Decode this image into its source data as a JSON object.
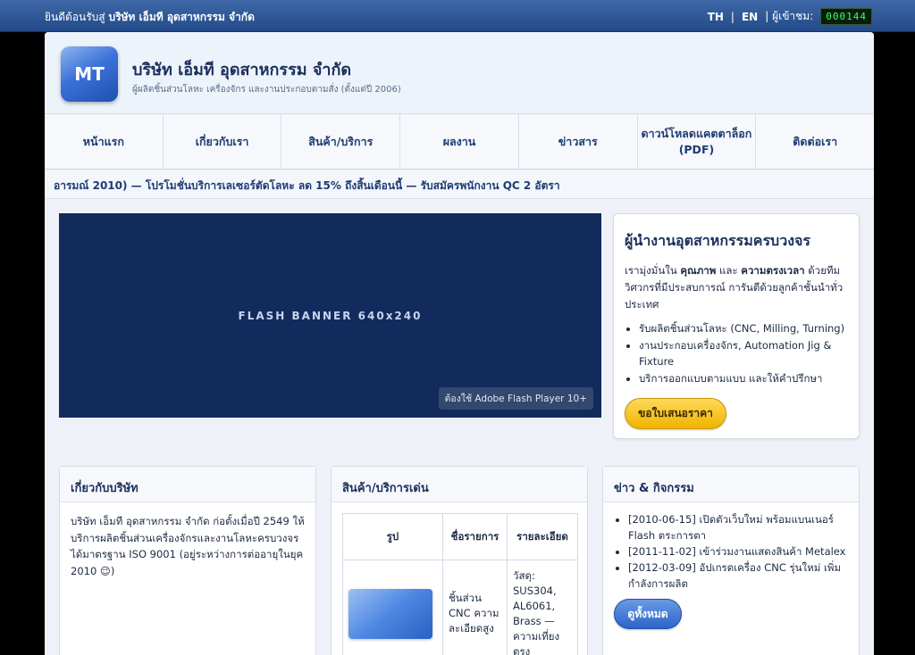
{
  "topbar": {
    "welcome_prefix": "ยินดีต้อนรับสู่",
    "welcome_company": "บริษัท เอ็มที อุดสาหกรรม จำกัด",
    "lang_th": "TH",
    "lang_sep": "|",
    "lang_en": "EN",
    "visitors_label": "| ผู้เข้าชม:",
    "visitors_count": "000144"
  },
  "header": {
    "logo_text": "MT",
    "company_name": "บริษัท เอ็มที อุดสาหกรรม จำกัด",
    "tagline": "ผู้ผลิตชิ้นส่วนโลหะ เครื่องจักร และงานประกอบตามสั่ง (ตั้งแต่ปี 2006)"
  },
  "nav": {
    "items": [
      {
        "label": "หน้าแรก"
      },
      {
        "label": "เกี่ยวกับเรา"
      },
      {
        "label": "สินค้า/บริการ"
      },
      {
        "label": "ผลงาน"
      },
      {
        "label": "ข่าวสาร"
      },
      {
        "label": "ดาวน์โหลดแคตตาล็อก (PDF)"
      },
      {
        "label": "ติดต่อเรา"
      }
    ]
  },
  "ticker": {
    "text": "อารมณ์ 2010) — โปรโมชั่นบริการเลเซอร์ตัดโลหะ ลด 15% ถึงสิ้นเดือนนี้ — รับสมัครพนักงาน QC 2 อัตรา"
  },
  "banner": {
    "label": "FLASH BANNER 640x240",
    "requirement": "ต้องใช้ Adobe Flash Player 10+"
  },
  "promo": {
    "title": "ผู้นำงานอุตสาหกรรมครบวงจร",
    "desc_1": "เรามุ่งมั่นใน ",
    "desc_bold_1": "คุณภาพ",
    "desc_2": " และ ",
    "desc_bold_2": "ความตรงเวลา",
    "desc_3": " ด้วยทีมวิศวกรที่มีประสบการณ์ การันตีด้วยลูกค้าชั้นนำทั่วประเทศ",
    "bullets": [
      "รับผลิตชิ้นส่วนโลหะ (CNC, Milling, Turning)",
      "งานประกอบเครื่องจักร, Automation Jig & Fixture",
      "บริการออกแบบตามแบบ และให้คำปรึกษา"
    ],
    "quote_button": "ขอใบเสนอราคา"
  },
  "about": {
    "title": "เกี่ยวกับบริษัท",
    "body": "บริษัท เอ็มที อุดสาหกรรม จำกัด ก่อตั้งเมื่อปี 2549 ให้บริการผลิตชิ้นส่วนเครื่องจักรและงานโลหะครบวงจร ได้มาตรฐาน ISO 9001 (อยู่ระหว่างการต่ออายุในยุค 2010 😉)"
  },
  "products": {
    "title": "สินค้า/บริการเด่น",
    "headers": [
      "รูป",
      "ชื่อรายการ",
      "รายละเอียด"
    ],
    "rows": [
      {
        "name": "ชิ้นส่วน CNC ความละเอียดสูง",
        "detail": "วัสดุ: SUS304, AL6061, Brass — ความเที่ยงตรง"
      }
    ]
  },
  "news": {
    "title": "ข่าว & กิจกรรม",
    "items": [
      "[2010-06-15] เปิดตัวเว็บใหม่ พร้อมแบนเนอร์ Flash ตระการตา",
      "[2011-11-02] เข้าร่วมงานแสดงสินค้า Metalex",
      "[2012-03-09] อัปเกรดเครื่อง CNC รุ่นใหม่ เพิ่มกำลังการผลิต"
    ],
    "see_all": "ดูทั้งหมด"
  }
}
